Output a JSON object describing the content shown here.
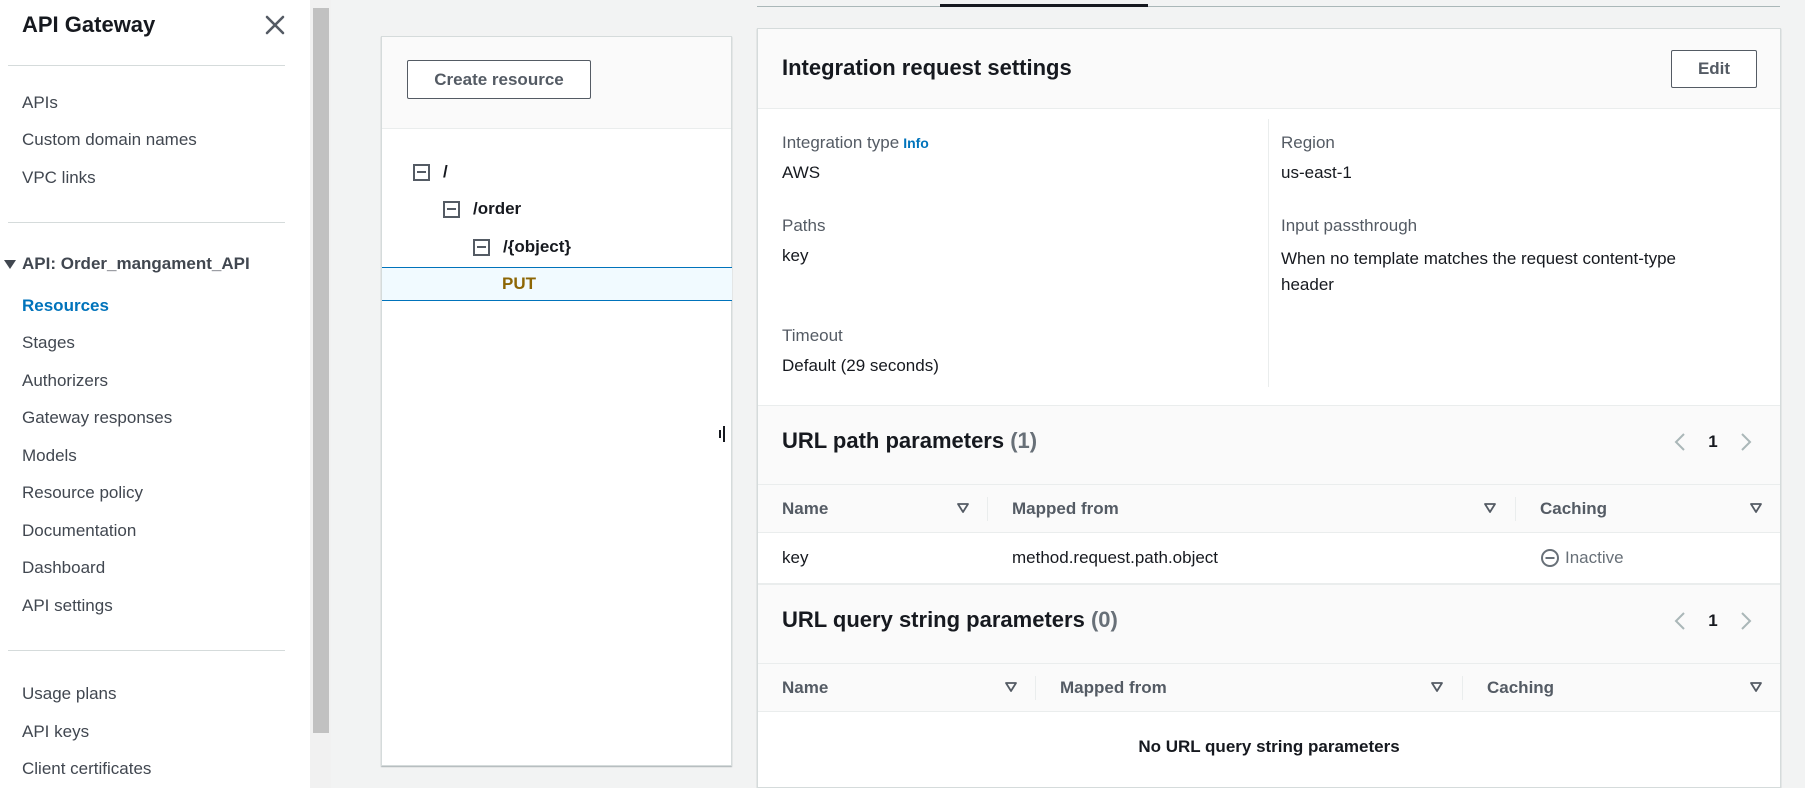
{
  "sidebar": {
    "title": "API Gateway",
    "top_items": [
      "APIs",
      "Custom domain names",
      "VPC links"
    ],
    "api_group": "API: Order_mangament_API",
    "api_items": [
      "Resources",
      "Stages",
      "Authorizers",
      "Gateway responses",
      "Models",
      "Resource policy",
      "Documentation",
      "Dashboard",
      "API settings"
    ],
    "bottom_items": [
      "Usage plans",
      "API keys",
      "Client certificates"
    ],
    "active_item": "Resources"
  },
  "resources": {
    "create_button": "Create resource",
    "tree": [
      {
        "path": "/"
      },
      {
        "path": "/order"
      },
      {
        "path": "/{object}"
      }
    ],
    "method": "PUT"
  },
  "integration": {
    "title": "Integration request settings",
    "edit_button": "Edit",
    "info_link": "Info",
    "fields": {
      "integration_type_label": "Integration type",
      "integration_type_value": "AWS",
      "region_label": "Region",
      "region_value": "us-east-1",
      "paths_label": "Paths",
      "paths_value": "key",
      "input_passthrough_label": "Input passthrough",
      "input_passthrough_value": "When no template matches the request content-type header",
      "timeout_label": "Timeout",
      "timeout_value": "Default (29 seconds)"
    }
  },
  "url_path_params": {
    "title": "URL path parameters",
    "count": "(1)",
    "page": "1",
    "columns": [
      "Name",
      "Mapped from",
      "Caching"
    ],
    "rows": [
      {
        "name": "key",
        "mapped_from": "method.request.path.object",
        "caching": "Inactive"
      }
    ]
  },
  "url_query_params": {
    "title": "URL query string parameters",
    "count": "(0)",
    "page": "1",
    "columns": [
      "Name",
      "Mapped from",
      "Caching"
    ],
    "empty_message": "No URL query string parameters"
  },
  "colors": {
    "accent": "#0073bb",
    "method": "#8d6605",
    "text": "#16191f",
    "muted": "#545b64"
  }
}
